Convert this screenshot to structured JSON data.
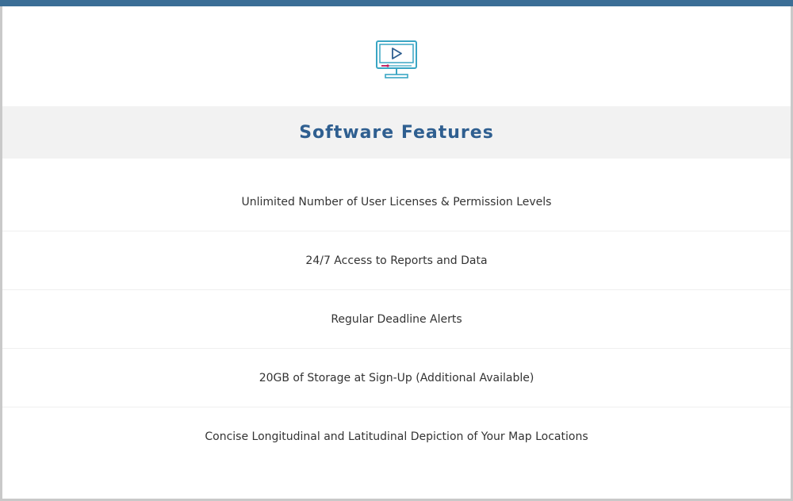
{
  "header": {
    "icon": "monitor-play-icon",
    "title": "Software Features",
    "accent_color": "#3b6e96",
    "title_color": "#2f5f90",
    "icon_color": "#3aa6c4"
  },
  "features": [
    {
      "label": "Unlimited Number of User Licenses & Permission Levels"
    },
    {
      "label": "24/7 Access to Reports and Data"
    },
    {
      "label": "Regular Deadline Alerts"
    },
    {
      "label": "20GB of Storage at Sign-Up (Additional Available)"
    },
    {
      "label": "Concise Longitudinal and Latitudinal Depiction of Your Map Locations"
    }
  ]
}
